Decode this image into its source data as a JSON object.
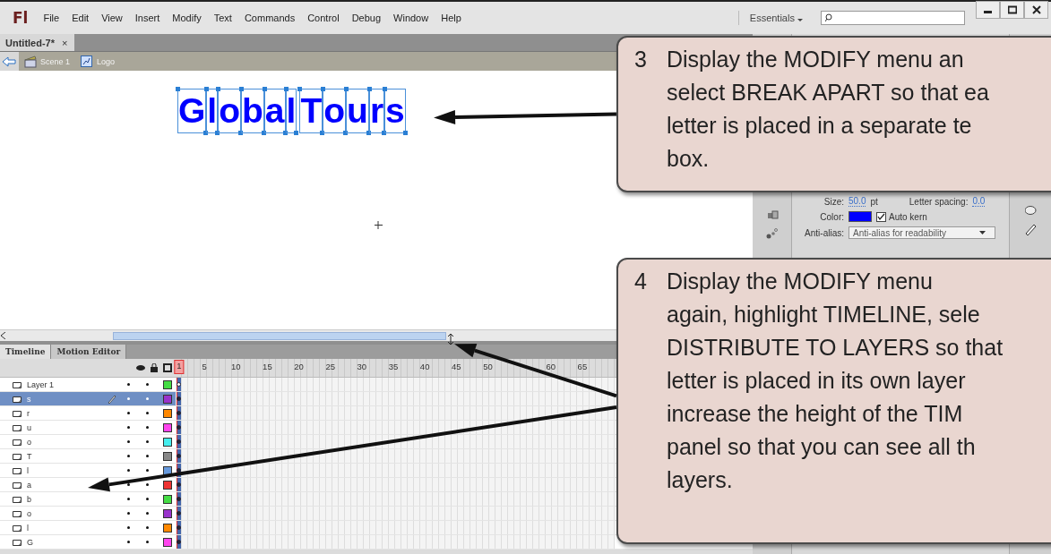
{
  "menubar": {
    "logo": "Fl",
    "menus": [
      "File",
      "Edit",
      "View",
      "Insert",
      "Modify",
      "Text",
      "Commands",
      "Control",
      "Debug",
      "Window",
      "Help"
    ],
    "workspace": "Essentials"
  },
  "document_tab": {
    "title": "Untitled-7*",
    "close": "×"
  },
  "breadcrumb": [
    {
      "kind": "scene",
      "label": "Scene 1"
    },
    {
      "kind": "symbol",
      "label": "Logo"
    }
  ],
  "stage": {
    "words": [
      [
        "G",
        "l",
        "o",
        "b",
        "a",
        "l"
      ],
      [
        "T",
        "o",
        "u",
        "r",
        "s"
      ]
    ]
  },
  "timeline": {
    "tabs": [
      {
        "label": "Timeline",
        "selected": true
      },
      {
        "label": "Motion Editor",
        "selected": false
      }
    ],
    "frame_labels": [
      "1",
      "5",
      "10",
      "15",
      "20",
      "25",
      "30",
      "35",
      "40",
      "45",
      "50",
      "60",
      "65"
    ],
    "layers": [
      {
        "name": "Layer 1",
        "selected": false,
        "color": "#44dd44",
        "keyframe_filled": false
      },
      {
        "name": "s",
        "selected": true,
        "color": "#9933cc",
        "keyframe_filled": true
      },
      {
        "name": "r",
        "selected": false,
        "color": "#ff8800",
        "keyframe_filled": true
      },
      {
        "name": "u",
        "selected": false,
        "color": "#ff44ee",
        "keyframe_filled": true
      },
      {
        "name": "o",
        "selected": false,
        "color": "#44eeee",
        "keyframe_filled": true
      },
      {
        "name": "T",
        "selected": false,
        "color": "#888888",
        "keyframe_filled": true
      },
      {
        "name": "l",
        "selected": false,
        "color": "#6699dd",
        "keyframe_filled": true
      },
      {
        "name": "a",
        "selected": false,
        "color": "#ee3333",
        "keyframe_filled": true
      },
      {
        "name": "b",
        "selected": false,
        "color": "#44dd44",
        "keyframe_filled": true
      },
      {
        "name": "o",
        "selected": false,
        "color": "#9933cc",
        "keyframe_filled": true
      },
      {
        "name": "l",
        "selected": false,
        "color": "#ff8800",
        "keyframe_filled": true
      },
      {
        "name": "G",
        "selected": false,
        "color": "#ff44ee",
        "keyframe_filled": true
      }
    ]
  },
  "properties": {
    "size_label": "Size:",
    "size_value": "50.0",
    "size_unit": "pt",
    "spacing_label": "Letter spacing:",
    "spacing_value": "0.0",
    "color_label": "Color:",
    "auto_kern": {
      "label": "Auto kern",
      "checked": true
    },
    "anti_alias_label": "Anti-alias:",
    "anti_alias_value": "Anti-alias for readability"
  },
  "callouts": [
    {
      "number": "3",
      "lines": [
        "Display the MODIFY menu an",
        "select BREAK APART so that ea",
        "letter is placed in a separate te",
        "box."
      ]
    },
    {
      "number": "4",
      "lines": [
        "Display the MODIFY menu",
        "again, highlight TIMELINE, sele",
        "DISTRIBUTE TO LAYERS so that",
        "letter is placed in its own layer",
        "increase the height of the TIM",
        "panel so that you can see all th",
        "layers."
      ]
    }
  ]
}
